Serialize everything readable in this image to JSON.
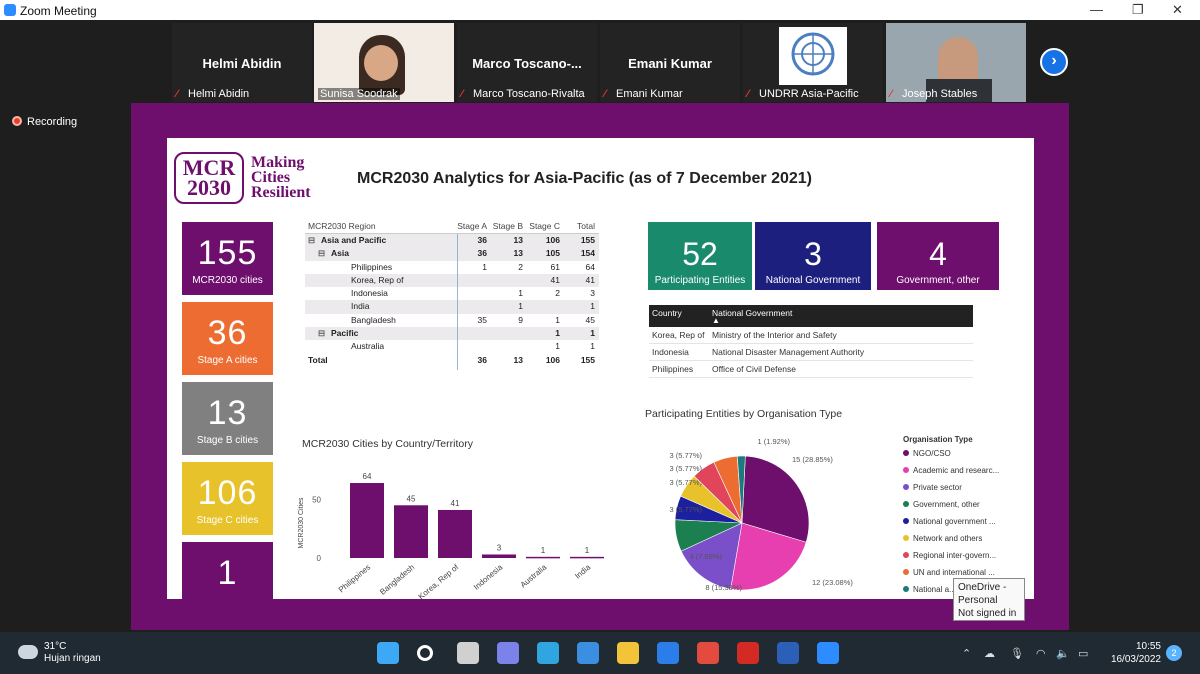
{
  "window": {
    "title": "Zoom Meeting",
    "minimize": "—",
    "maximize": "❐",
    "close": "✕"
  },
  "participants": [
    {
      "display": "Helmi Abidin",
      "label": "Helmi Abidin",
      "muted": true,
      "video": false
    },
    {
      "display": "",
      "label": "Sunisa Soodrak",
      "muted": false,
      "video": true
    },
    {
      "display": "Marco  Toscano-...",
      "label": "Marco Toscano-Rivalta",
      "muted": true,
      "video": false
    },
    {
      "display": "Emani Kumar",
      "label": "Emani Kumar",
      "muted": true,
      "video": false
    },
    {
      "display": "",
      "label": "UNDRR Asia-Pacific",
      "muted": true,
      "video": false
    },
    {
      "display": "",
      "label": "Joseph Stables",
      "muted": true,
      "video": true
    }
  ],
  "recording": "Recording",
  "slide": {
    "logo_main": "MCR 2030",
    "logo_text": [
      "Making",
      "Cities",
      "Resilient"
    ],
    "title": "MCR2030 Analytics for Asia-Pacific (as of 7 December 2021)",
    "kpis": [
      {
        "value": "155",
        "label": "MCR2030 cities",
        "color": "#6e0e6d"
      },
      {
        "value": "36",
        "label": "Stage A cities",
        "color": "#ec6c32"
      },
      {
        "value": "13",
        "label": "Stage B cities",
        "color": "#808080"
      },
      {
        "value": "106",
        "label": "Stage C cities",
        "color": "#e8c22a"
      },
      {
        "value": "1",
        "label": "",
        "color": "#6e0e6d"
      }
    ],
    "region_table": {
      "headers": [
        "MCR2030 Region",
        "Stage A",
        "Stage B",
        "Stage C",
        "Total"
      ],
      "rows": [
        {
          "name": "Asia and Pacific",
          "level": 0,
          "bold": true,
          "expand": "⊟",
          "a": "36",
          "b": "13",
          "c": "106",
          "t": "155",
          "hl": true
        },
        {
          "name": "Asia",
          "level": 1,
          "bold": true,
          "expand": "⊟",
          "a": "36",
          "b": "13",
          "c": "105",
          "t": "154",
          "hl": true
        },
        {
          "name": "Philippines",
          "level": 2,
          "bold": false,
          "expand": "",
          "a": "1",
          "b": "2",
          "c": "61",
          "t": "64",
          "hl": false
        },
        {
          "name": "Korea, Rep of",
          "level": 2,
          "bold": false,
          "expand": "",
          "a": "",
          "b": "",
          "c": "41",
          "t": "41",
          "hl": true
        },
        {
          "name": "Indonesia",
          "level": 2,
          "bold": false,
          "expand": "",
          "a": "",
          "b": "1",
          "c": "2",
          "t": "3",
          "hl": false
        },
        {
          "name": "India",
          "level": 2,
          "bold": false,
          "expand": "",
          "a": "",
          "b": "1",
          "c": "",
          "t": "1",
          "hl": true
        },
        {
          "name": "Bangladesh",
          "level": 2,
          "bold": false,
          "expand": "",
          "a": "35",
          "b": "9",
          "c": "1",
          "t": "45",
          "hl": false
        },
        {
          "name": "Pacific",
          "level": 1,
          "bold": true,
          "expand": "⊟",
          "a": "",
          "b": "",
          "c": "1",
          "t": "1",
          "hl": true
        },
        {
          "name": "Australia",
          "level": 2,
          "bold": false,
          "expand": "",
          "a": "",
          "b": "",
          "c": "1",
          "t": "1",
          "hl": false
        },
        {
          "name": "Total",
          "level": 0,
          "bold": true,
          "expand": "",
          "a": "36",
          "b": "13",
          "c": "106",
          "t": "155",
          "hl": false
        }
      ]
    },
    "org_kpis": [
      {
        "value": "52",
        "label": "Participating Entities",
        "color": "#1a8a6c"
      },
      {
        "value": "3",
        "label": "National Government",
        "color": "#1c1f7e"
      },
      {
        "value": "4",
        "label": "Government, other",
        "color": "#6e0e6d"
      }
    ],
    "gov_table": {
      "headers": [
        "Country",
        "National Government"
      ],
      "rows": [
        [
          "Korea, Rep of",
          "Ministry of the Interior and Safety"
        ],
        [
          "Indonesia",
          "National Disaster Management Authority"
        ],
        [
          "Philippines",
          "Office of Civil Defense"
        ]
      ]
    },
    "bar_title": "MCR2030 Cities by Country/Territory",
    "pie_title": "Participating Entities by Organisation Type",
    "legend_title": "Organisation Type"
  },
  "chart_data": [
    {
      "type": "bar",
      "title": "MCR2030 Cities by Country/Territory",
      "ylabel": "MCR2030 Cities",
      "categories": [
        "Philippines",
        "Bangladesh",
        "Korea, Rep of",
        "Indonesia",
        "Australia",
        "India"
      ],
      "values": [
        64,
        45,
        41,
        3,
        1,
        1
      ],
      "yticks": [
        "50",
        "0"
      ],
      "ylim": [
        0,
        70
      ],
      "color": "#6e0e6d"
    },
    {
      "type": "pie",
      "title": "Participating Entities by Organisation Type",
      "slices": [
        {
          "name": "NGO/CSO",
          "value": 15,
          "label": "15 (28.85%)",
          "color": "#6e0e6d"
        },
        {
          "name": "Academic and researc...",
          "value": 12,
          "label": "12 (23.08%)",
          "color": "#e73fb0"
        },
        {
          "name": "Private sector",
          "value": 8,
          "label": "8 (15.38%)",
          "color": "#7a4fc9"
        },
        {
          "name": "Government, other",
          "value": 4,
          "label": "4 (7.69%)",
          "color": "#1b7f4f"
        },
        {
          "name": "National government ...",
          "value": 3,
          "label": "3 (5.77%)",
          "color": "#1c1f9e"
        },
        {
          "name": "Network and others",
          "value": 3,
          "label": "3 (5.77%)",
          "color": "#e8c22a"
        },
        {
          "name": "Regional inter-govern...",
          "value": 3,
          "label": "3 (5.77%)",
          "color": "#e0455c"
        },
        {
          "name": "UN and international ...",
          "value": 3,
          "label": "3 (5.77%)",
          "color": "#ec6c32"
        },
        {
          "name": "National a...",
          "value": 1,
          "label": "1 (1.92%)",
          "color": "#1a7a7c"
        }
      ]
    }
  ],
  "tooltip": [
    "OneDrive -",
    "Personal",
    "Not signed in"
  ],
  "taskbar": {
    "temp": "31°C",
    "weather": "Hujan ringan",
    "time": "10:55",
    "date": "16/03/2022",
    "notifications": "2",
    "apps": [
      "windows-start-icon",
      "search-icon",
      "task-view-icon",
      "teams-chat-icon",
      "edge-icon",
      "mail-icon",
      "file-explorer-icon",
      "dropbox-icon",
      "chrome-icon",
      "acrobat-icon",
      "word-icon",
      "zoom-icon"
    ]
  }
}
